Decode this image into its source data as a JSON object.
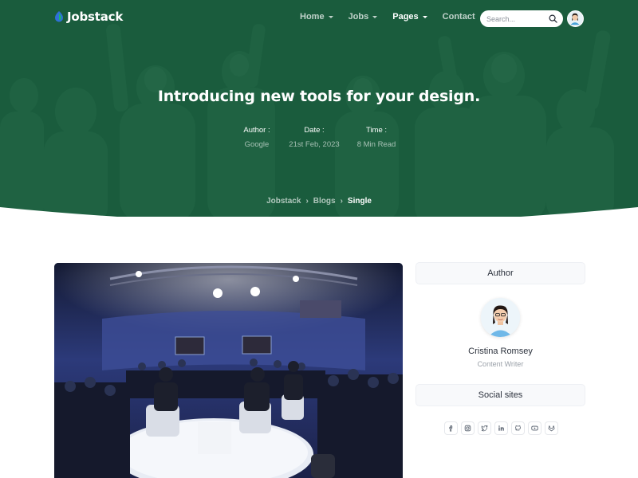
{
  "brand": {
    "name": "Jobstack",
    "accent": "#0f9a5b",
    "hero_overlay": "#105837"
  },
  "nav": {
    "items": [
      {
        "label": "Home",
        "dropdown": true,
        "active": false
      },
      {
        "label": "Jobs",
        "dropdown": true,
        "active": false
      },
      {
        "label": "Pages",
        "dropdown": true,
        "active": true
      },
      {
        "label": "Contact",
        "dropdown": false,
        "active": false
      }
    ],
    "search_placeholder": "Search...",
    "search_icon": "search-icon",
    "user_avatar": "user-avatar"
  },
  "hero": {
    "title": "Introducing new tools for your design.",
    "meta": [
      {
        "label": "Author :",
        "value": "Google"
      },
      {
        "label": "Date :",
        "value": "21st Feb, 2023"
      },
      {
        "label": "Time :",
        "value": "8 Min Read"
      }
    ],
    "breadcrumb": [
      "Jobstack",
      "Blogs",
      "Single"
    ]
  },
  "post": {
    "image": "conference-panel-photo"
  },
  "sidebar": {
    "author_heading": "Author",
    "author_name": "Cristina Romsey",
    "author_role": "Content Writer",
    "social_heading": "Social sites",
    "social_icons": [
      "facebook-icon",
      "instagram-icon",
      "twitter-icon",
      "linkedin-icon",
      "github-icon",
      "youtube-icon",
      "gitlab-icon"
    ]
  }
}
